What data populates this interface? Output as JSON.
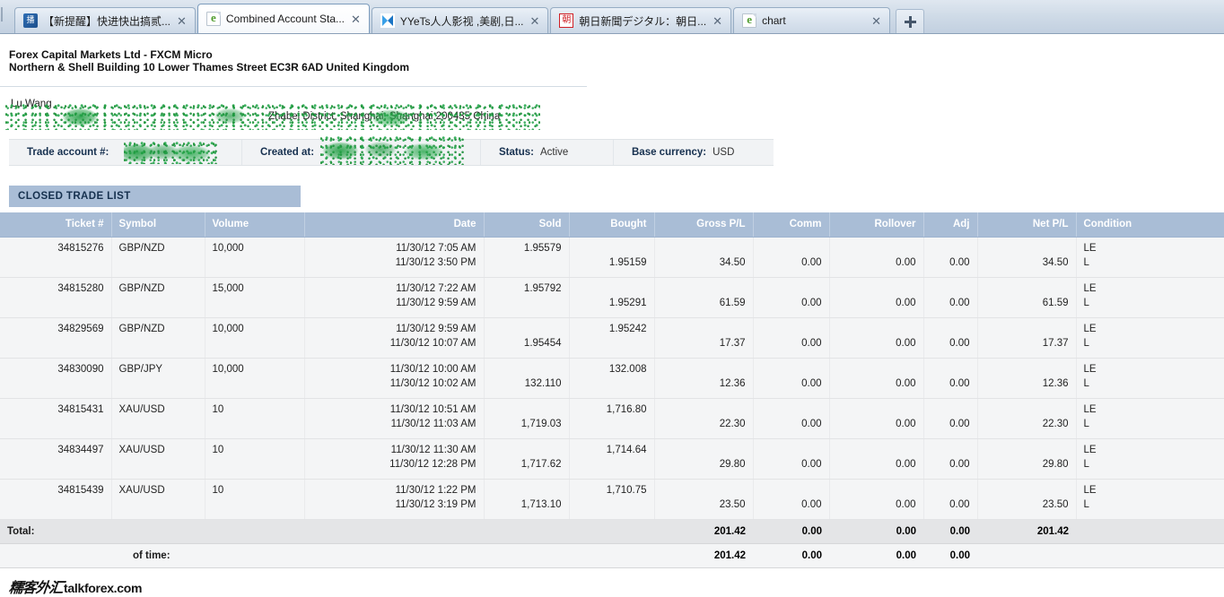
{
  "browser": {
    "tabs": [
      {
        "title": "【新提醒】快进快出搞贰...",
        "icon": "blue-square-favicon",
        "active": false,
        "close_label": "✕"
      },
      {
        "title": "Combined Account Sta...",
        "icon": "ie-page-favicon",
        "active": true,
        "close_label": "✕"
      },
      {
        "title": "YYeTs人人影视 ,美剧,日...",
        "icon": "yyets-favicon",
        "active": false,
        "close_label": "✕"
      },
      {
        "title": "朝日新聞デジタル：朝日...",
        "icon": "asahi-favicon",
        "active": false,
        "close_label": "✕"
      },
      {
        "title": "chart",
        "icon": "ie-page-favicon",
        "active": false,
        "close_label": "✕"
      }
    ],
    "new_tab_label": "+"
  },
  "broker": {
    "line1": "Forex Capital Markets Ltd - FXCM Micro",
    "line2": "Northern & Shell Building 10 Lower Thames Street EC3R 6AD United Kingdom"
  },
  "client": {
    "name": "Lu Wang",
    "address": "Zhabei District, Shanghai, Shanghai 200435 China"
  },
  "account_info": [
    {
      "label": "Trade account #:",
      "value": ""
    },
    {
      "label": "Created at:",
      "value": ""
    },
    {
      "label": "Status:",
      "value": "Active"
    },
    {
      "label": "Base currency:",
      "value": "USD"
    }
  ],
  "section": {
    "title": "CLOSED TRADE LIST"
  },
  "table": {
    "columns": [
      {
        "key": "ticket",
        "label": "Ticket #",
        "align": "right"
      },
      {
        "key": "symbol",
        "label": "Symbol",
        "align": "left"
      },
      {
        "key": "volume",
        "label": "Volume",
        "align": "left"
      },
      {
        "key": "date",
        "label": "Date",
        "align": "right"
      },
      {
        "key": "sold",
        "label": "Sold",
        "align": "right"
      },
      {
        "key": "bought",
        "label": "Bought",
        "align": "right"
      },
      {
        "key": "gross_pl",
        "label": "Gross P/L",
        "align": "right"
      },
      {
        "key": "comm",
        "label": "Comm",
        "align": "right"
      },
      {
        "key": "rollover",
        "label": "Rollover",
        "align": "right"
      },
      {
        "key": "adj",
        "label": "Adj",
        "align": "right"
      },
      {
        "key": "net_pl",
        "label": "Net P/L",
        "align": "right"
      },
      {
        "key": "condition",
        "label": "Condition",
        "align": "left"
      }
    ],
    "rows": [
      {
        "ticket": "34815276",
        "symbol": "GBP/NZD",
        "volume": "10,000",
        "date_open": "11/30/12 7:05 AM",
        "date_close": "11/30/12 3:50 PM",
        "sold": "1.95579",
        "sold_line": "top",
        "bought": "1.95159",
        "bought_line": "bottom",
        "gross_pl": "34.50",
        "comm": "0.00",
        "rollover": "0.00",
        "adj": "0.00",
        "net_pl": "34.50",
        "condition_top": "LE",
        "condition_bottom": "L"
      },
      {
        "ticket": "34815280",
        "symbol": "GBP/NZD",
        "volume": "15,000",
        "date_open": "11/30/12 7:22 AM",
        "date_close": "11/30/12 9:59 AM",
        "sold": "1.95792",
        "sold_line": "top",
        "bought": "1.95291",
        "bought_line": "bottom",
        "gross_pl": "61.59",
        "comm": "0.00",
        "rollover": "0.00",
        "adj": "0.00",
        "net_pl": "61.59",
        "condition_top": "LE",
        "condition_bottom": "L"
      },
      {
        "ticket": "34829569",
        "symbol": "GBP/NZD",
        "volume": "10,000",
        "date_open": "11/30/12 9:59 AM",
        "date_close": "11/30/12 10:07 AM",
        "sold": "1.95454",
        "sold_line": "bottom",
        "bought": "1.95242",
        "bought_line": "top",
        "gross_pl": "17.37",
        "comm": "0.00",
        "rollover": "0.00",
        "adj": "0.00",
        "net_pl": "17.37",
        "condition_top": "LE",
        "condition_bottom": "L"
      },
      {
        "ticket": "34830090",
        "symbol": "GBP/JPY",
        "volume": "10,000",
        "date_open": "11/30/12 10:00 AM",
        "date_close": "11/30/12 10:02 AM",
        "sold": "132.110",
        "sold_line": "bottom",
        "bought": "132.008",
        "bought_line": "top",
        "gross_pl": "12.36",
        "comm": "0.00",
        "rollover": "0.00",
        "adj": "0.00",
        "net_pl": "12.36",
        "condition_top": "LE",
        "condition_bottom": "L"
      },
      {
        "ticket": "34815431",
        "symbol": "XAU/USD",
        "volume": "10",
        "date_open": "11/30/12 10:51 AM",
        "date_close": "11/30/12 11:03 AM",
        "sold": "1,719.03",
        "sold_line": "bottom",
        "bought": "1,716.80",
        "bought_line": "top",
        "gross_pl": "22.30",
        "comm": "0.00",
        "rollover": "0.00",
        "adj": "0.00",
        "net_pl": "22.30",
        "condition_top": "LE",
        "condition_bottom": "L"
      },
      {
        "ticket": "34834497",
        "symbol": "XAU/USD",
        "volume": "10",
        "date_open": "11/30/12 11:30 AM",
        "date_close": "11/30/12 12:28 PM",
        "sold": "1,717.62",
        "sold_line": "bottom",
        "bought": "1,714.64",
        "bought_line": "top",
        "gross_pl": "29.80",
        "comm": "0.00",
        "rollover": "0.00",
        "adj": "0.00",
        "net_pl": "29.80",
        "condition_top": "LE",
        "condition_bottom": "L"
      },
      {
        "ticket": "34815439",
        "symbol": "XAU/USD",
        "volume": "10",
        "date_open": "11/30/12 1:22 PM",
        "date_close": "11/30/12 3:19 PM",
        "sold": "1,713.10",
        "sold_line": "bottom",
        "bought": "1,710.75",
        "bought_line": "top",
        "gross_pl": "23.50",
        "comm": "0.00",
        "rollover": "0.00",
        "adj": "0.00",
        "net_pl": "23.50",
        "condition_top": "LE",
        "condition_bottom": "L"
      }
    ],
    "totals": [
      {
        "label": "Total:",
        "gross_pl": "201.42",
        "comm": "0.00",
        "rollover": "0.00",
        "adj": "0.00",
        "net_pl": "201.42"
      },
      {
        "label": "of time:",
        "gross_pl": "201.42",
        "comm": "0.00",
        "rollover": "0.00",
        "adj": "0.00",
        "net_pl": ""
      }
    ]
  },
  "watermark": {
    "cn": "糯客外汇",
    "en": "talkforex.com"
  },
  "colors": {
    "header_blue": "#a9bdd6",
    "section_blue": "#a9bdd6",
    "row_bg": "#f4f5f6",
    "total_bg": "#e4e5e7",
    "redaction_green": "#229e42",
    "tabstrip": "#cdd9e6"
  }
}
